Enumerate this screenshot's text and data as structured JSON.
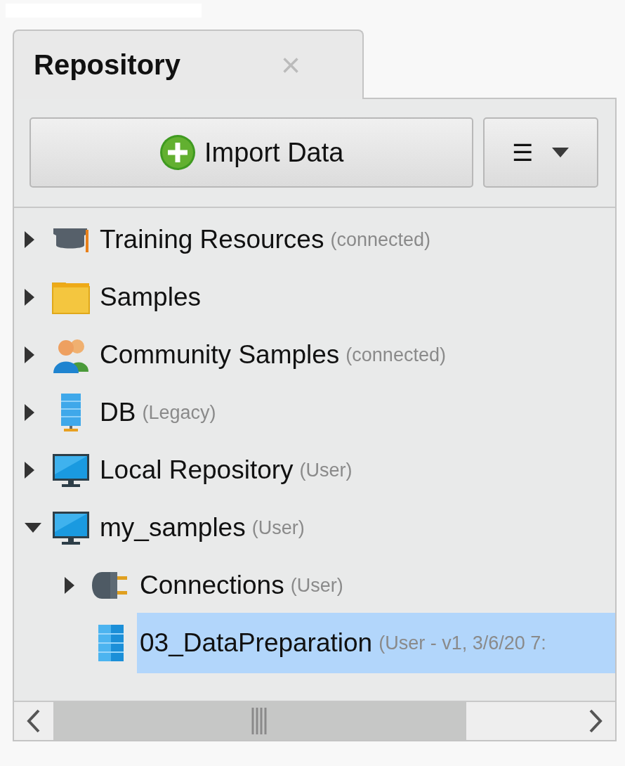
{
  "tab": {
    "title": "Repository",
    "close": "×"
  },
  "toolbar": {
    "import_button": "Import Data",
    "menu_button": "☰"
  },
  "tree": [
    {
      "label": "Training Resources",
      "note": "(connected)",
      "kind": "cap",
      "expanded": false,
      "selected": false
    },
    {
      "label": "Samples",
      "kind": "folder",
      "expanded": false,
      "selected": false
    },
    {
      "label": "Community Samples",
      "note": "(connected)",
      "kind": "people",
      "expanded": false,
      "selected": false
    },
    {
      "label": "DB",
      "note": "(Legacy)",
      "kind": "server",
      "expanded": false,
      "selected": false
    },
    {
      "label": "Local Repository",
      "note": "(User)",
      "kind": "monitor",
      "expanded": false,
      "selected": false
    },
    {
      "label": "my_samples",
      "note": "(User)",
      "kind": "monitor",
      "expanded": true,
      "selected": false,
      "children": [
        {
          "label": "Connections",
          "note": "(User)",
          "kind": "plug",
          "expanded": false,
          "selected": false
        },
        {
          "label": "03_DataPreparation",
          "note": "(User - v1, 3/6/20 7:",
          "kind": "table",
          "selected": true
        }
      ]
    }
  ]
}
